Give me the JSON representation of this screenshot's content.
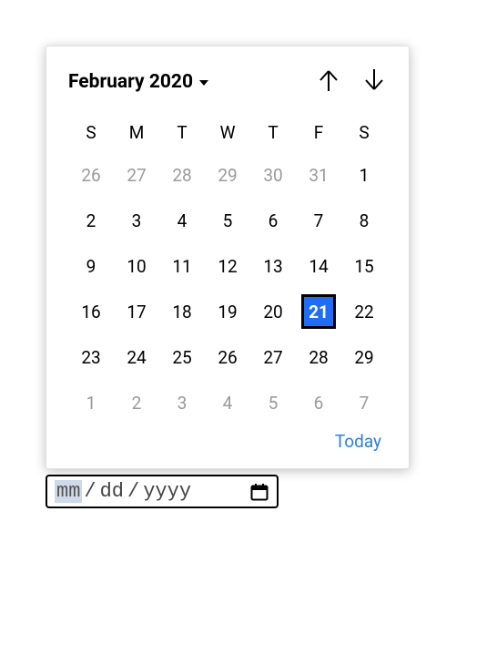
{
  "calendar": {
    "monthYear": "February 2020",
    "weekdays": [
      "S",
      "M",
      "T",
      "W",
      "T",
      "F",
      "S"
    ],
    "weeks": [
      [
        {
          "d": "26",
          "other": true,
          "selected": false
        },
        {
          "d": "27",
          "other": true,
          "selected": false
        },
        {
          "d": "28",
          "other": true,
          "selected": false
        },
        {
          "d": "29",
          "other": true,
          "selected": false
        },
        {
          "d": "30",
          "other": true,
          "selected": false
        },
        {
          "d": "31",
          "other": true,
          "selected": false
        },
        {
          "d": "1",
          "other": false,
          "selected": false
        }
      ],
      [
        {
          "d": "2",
          "other": false,
          "selected": false
        },
        {
          "d": "3",
          "other": false,
          "selected": false
        },
        {
          "d": "4",
          "other": false,
          "selected": false
        },
        {
          "d": "5",
          "other": false,
          "selected": false
        },
        {
          "d": "6",
          "other": false,
          "selected": false
        },
        {
          "d": "7",
          "other": false,
          "selected": false
        },
        {
          "d": "8",
          "other": false,
          "selected": false
        }
      ],
      [
        {
          "d": "9",
          "other": false,
          "selected": false
        },
        {
          "d": "10",
          "other": false,
          "selected": false
        },
        {
          "d": "11",
          "other": false,
          "selected": false
        },
        {
          "d": "12",
          "other": false,
          "selected": false
        },
        {
          "d": "13",
          "other": false,
          "selected": false
        },
        {
          "d": "14",
          "other": false,
          "selected": false
        },
        {
          "d": "15",
          "other": false,
          "selected": false
        }
      ],
      [
        {
          "d": "16",
          "other": false,
          "selected": false
        },
        {
          "d": "17",
          "other": false,
          "selected": false
        },
        {
          "d": "18",
          "other": false,
          "selected": false
        },
        {
          "d": "19",
          "other": false,
          "selected": false
        },
        {
          "d": "20",
          "other": false,
          "selected": false
        },
        {
          "d": "21",
          "other": false,
          "selected": true
        },
        {
          "d": "22",
          "other": false,
          "selected": false
        }
      ],
      [
        {
          "d": "23",
          "other": false,
          "selected": false
        },
        {
          "d": "24",
          "other": false,
          "selected": false
        },
        {
          "d": "25",
          "other": false,
          "selected": false
        },
        {
          "d": "26",
          "other": false,
          "selected": false
        },
        {
          "d": "27",
          "other": false,
          "selected": false
        },
        {
          "d": "28",
          "other": false,
          "selected": false
        },
        {
          "d": "29",
          "other": false,
          "selected": false
        }
      ],
      [
        {
          "d": "1",
          "other": true,
          "selected": false
        },
        {
          "d": "2",
          "other": true,
          "selected": false
        },
        {
          "d": "3",
          "other": true,
          "selected": false
        },
        {
          "d": "4",
          "other": true,
          "selected": false
        },
        {
          "d": "5",
          "other": true,
          "selected": false
        },
        {
          "d": "6",
          "other": true,
          "selected": false
        },
        {
          "d": "7",
          "other": true,
          "selected": false
        }
      ]
    ],
    "todayLabel": "Today"
  },
  "dateInput": {
    "mm": "mm",
    "dd": "dd",
    "yyyy": "yyyy",
    "sep": "/"
  }
}
